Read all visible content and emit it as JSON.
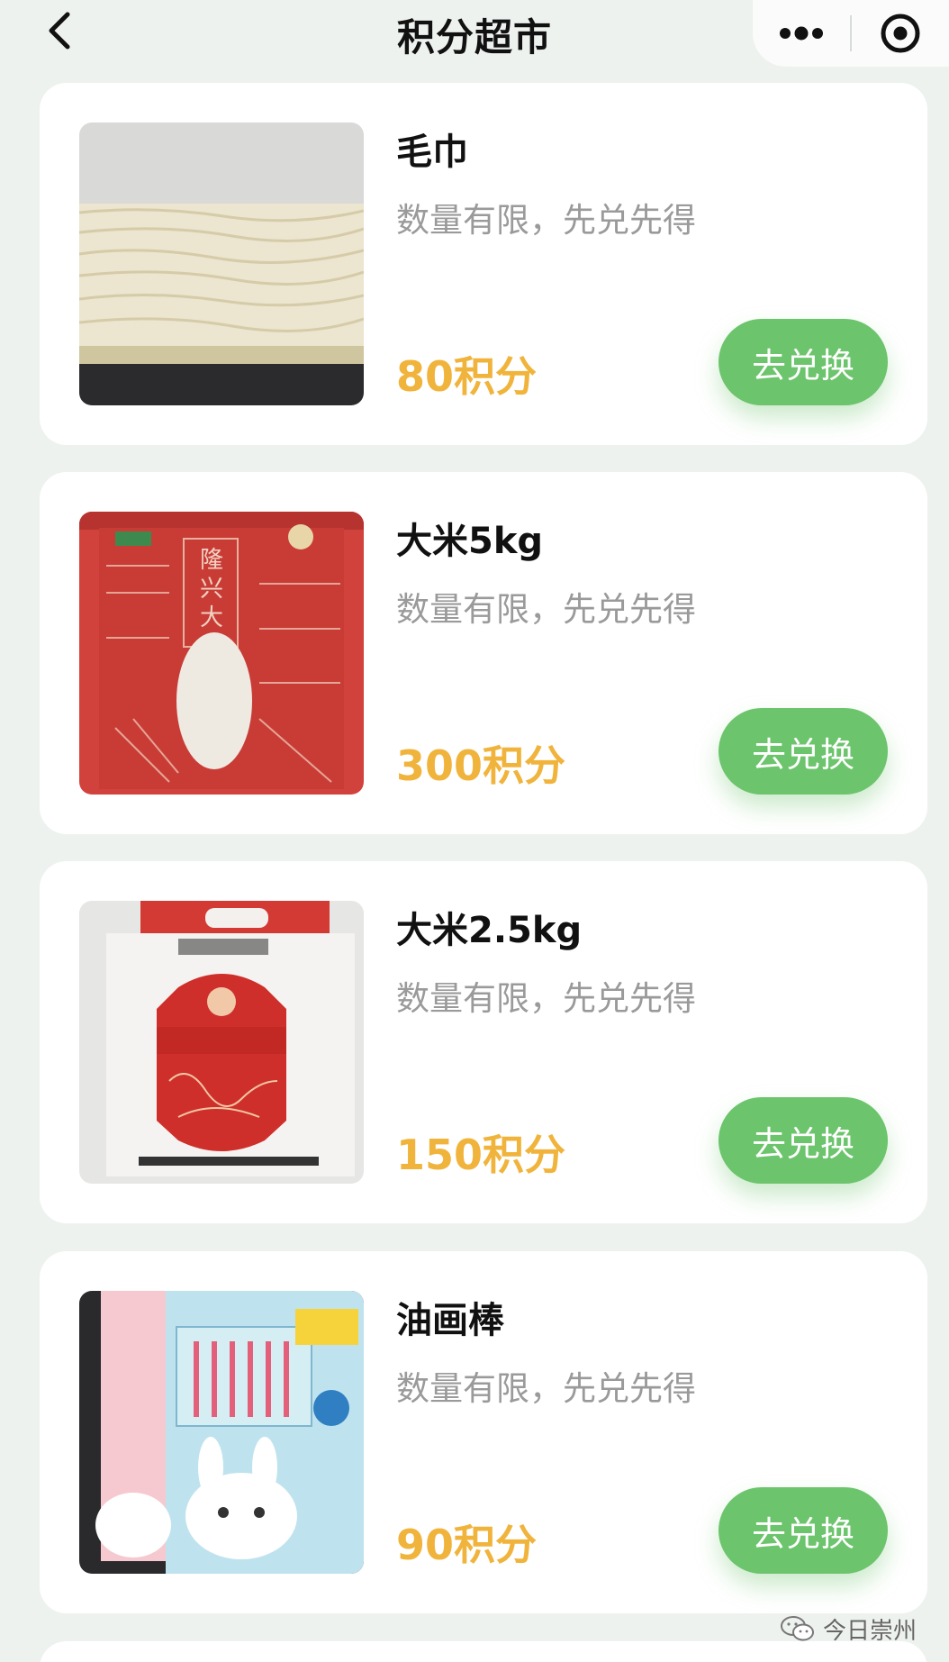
{
  "header": {
    "title": "积分超市"
  },
  "products": [
    {
      "name": "毛巾",
      "desc": "数量有限，先兑先得",
      "price": "80积分",
      "button": "去兑换",
      "image": "towel-photo"
    },
    {
      "name": "大米5kg",
      "desc": "数量有限，先兑先得",
      "price": "300积分",
      "button": "去兑换",
      "image": "rice-bag-red-photo"
    },
    {
      "name": "大米2.5kg",
      "desc": "数量有限，先兑先得",
      "price": "150积分",
      "button": "去兑换",
      "image": "rice-bag-white-photo"
    },
    {
      "name": "油画棒",
      "desc": "数量有限，先兑先得",
      "price": "90积分",
      "button": "去兑换",
      "image": "oil-pastel-box-photo"
    }
  ],
  "watermark": {
    "text": "今日崇州",
    "icon": "wechat-icon"
  },
  "colors": {
    "accent_green": "#6cc46c",
    "price_orange": "#f0b43c",
    "background": "#eef2ee"
  }
}
